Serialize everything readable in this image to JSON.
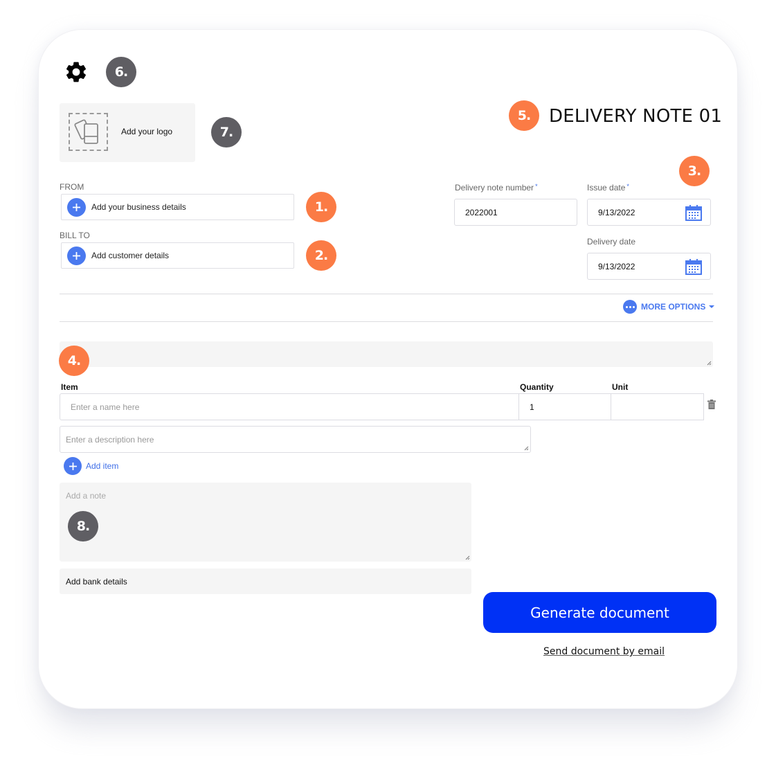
{
  "settings": {
    "icon": "gear-icon"
  },
  "logo": {
    "label": "Add your logo",
    "icon": "image-placeholder-icon"
  },
  "document": {
    "title": "DELIVERY NOTE 01"
  },
  "from": {
    "label": "FROM",
    "button": "Add your business details"
  },
  "bill_to": {
    "label": "BILL TO",
    "button": "Add customer details"
  },
  "fields": {
    "note_number": {
      "label": "Delivery note number",
      "required_mark": "*",
      "value": "2022001"
    },
    "issue_date": {
      "label": "Issue date",
      "required_mark": "*",
      "value": "9/13/2022"
    },
    "delivery_date": {
      "label": "Delivery date",
      "value": "9/13/2022"
    }
  },
  "more_options": {
    "label": "MORE OPTIONS"
  },
  "items_table": {
    "columns": {
      "item": "Item",
      "quantity": "Quantity",
      "unit": "Unit"
    },
    "rows": [
      {
        "name_placeholder": "Enter a name here",
        "quantity": "1",
        "unit": "",
        "description_placeholder": "Enter a description here"
      }
    ],
    "add_item": "Add item"
  },
  "note": {
    "placeholder": "Add a note"
  },
  "bank": {
    "label": "Add bank details"
  },
  "actions": {
    "generate": "Generate document",
    "email": "Send document by email"
  },
  "annotations": {
    "b1": "1.",
    "b2": "2.",
    "b3": "3.",
    "b4": "4.",
    "b5": "5.",
    "b6": "6.",
    "b7": "7.",
    "b8": "8."
  },
  "colors": {
    "accent_blue": "#4a79ef",
    "primary_button": "#0031f5",
    "badge_orange": "#fb7b45",
    "badge_gray": "#5f5e63"
  }
}
